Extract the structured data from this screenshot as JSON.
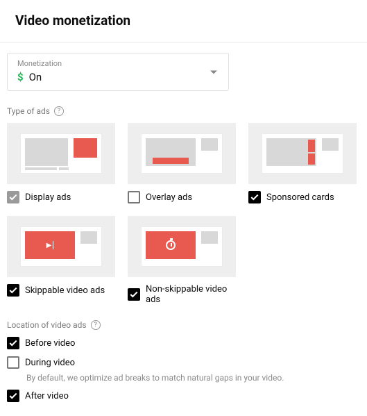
{
  "header": {
    "title": "Video monetization"
  },
  "monetization": {
    "label": "Monetization",
    "value": "On",
    "currency_symbol": "$"
  },
  "type_of_ads": {
    "label": "Type of ads",
    "items": [
      {
        "label": "Display ads",
        "checked": true,
        "locked": true
      },
      {
        "label": "Overlay ads",
        "checked": false
      },
      {
        "label": "Sponsored cards",
        "checked": true
      },
      {
        "label": "Skippable video ads",
        "checked": true
      },
      {
        "label": "Non-skippable video ads",
        "checked": true
      }
    ]
  },
  "location": {
    "label": "Location of video ads",
    "items": [
      {
        "label": "Before video",
        "checked": true
      },
      {
        "label": "During video",
        "checked": false,
        "hint": "By default, we optimize ad breaks to match natural gaps in your video."
      },
      {
        "label": "After video",
        "checked": true
      }
    ]
  }
}
